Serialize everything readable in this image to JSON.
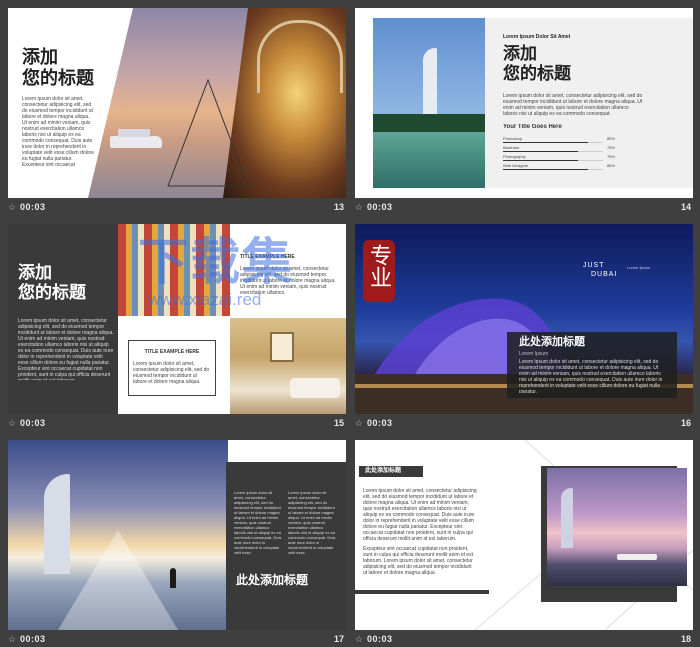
{
  "slides": [
    {
      "number": "13",
      "duration": "00:03",
      "title_line1": "添加",
      "title_line2": "您的标题",
      "body": "Lorem ipsum dolor sit amet, consectetur adipisicing elit, sed do eiusmod tempor incididunt ut labore et dolore magna aliqua. Ut enim ad minim veniam, quis nostrud exercitation ullamco laboris nisi ut aliquip ex ea commodo consequat. Duis aute irure dolor in reprehenderit in voluptate velit esse cillum dolore eu fugiat nulla pariatur. Excepteur sint occaecat cupidatat non proident, sunt in culpa qui officia deserunt mollit anim id est laborum."
    },
    {
      "number": "14",
      "duration": "00:03",
      "kicker": "Lorem Ipsum Dolor Sit Amet",
      "title_line1": "添加",
      "title_line2": "您的标题",
      "body": "Lorem ipsum dolor sit amet, consectetur adipisicing elit, sed do eiusmod tempor incididunt ut labore et dolore magna aliqua. Ut enim ad minim veniam, quis nostrud exercitation ullamco laboris nisi ut aliquip ex ea commodo consequat.",
      "subtitle": "Your Title Goes Here",
      "bars": [
        {
          "label": "Photoshop",
          "value": "85%",
          "fraction": 0.85
        },
        {
          "label": "Illustrator",
          "value": "75%",
          "fraction": 0.75
        },
        {
          "label": "Photography",
          "value": "75%",
          "fraction": 0.75
        },
        {
          "label": "Web Designer",
          "value": "85%",
          "fraction": 0.85
        }
      ]
    },
    {
      "number": "15",
      "duration": "00:03",
      "title_line1": "添加",
      "title_line2": "您的标题",
      "body": "Lorem ipsum dolor sit amet, consectetur adipisicing elit, sed do eiusmod tempor incididunt ut labore et dolore magna aliqua. Ut enim ad minim veniam, quis nostrud exercitation ullamco laboris nisi ut aliquip ex ea commodo consequat. Duis aute irure dolor in reprehenderit in voluptate velit esse cillum dolore eu fugiat nulla pariatur. Excepteur sint occaecat cupidatat non proident, sunt in culpa qui officia deserunt mollit anim id est laborum.",
      "box_title": "TITLE EXAMPLE HERE",
      "box_body": "Lorem ipsum dolor sit amet, consectetur adipisicing elit, sed do eiusmod tempor incididunt ut labore et dolore magna aliqua.",
      "side_title": "TITLE EXAMPLE HERE",
      "side_body": "Lorem ipsum dolor sit amet, consectetur adipisicing elit, sed do eiusmod tempor incididunt ut labore et dolore magna aliqua. Ut enim ad minim veniam, quis nostrud exercitation ullamco."
    },
    {
      "number": "16",
      "duration": "00:03",
      "just": "JUST",
      "dubai": "DUBAI",
      "tagline": "Lorem Ipsum",
      "seal": "专业",
      "panel_title": "此处添加标题",
      "panel_sub": "Lorem Ipsum",
      "panel_body": "Lorem ipsum dolor sit amet, consectetur adipisicing elit, sed do eiusmod tempor incididunt ut labore et dolore magna aliqua. Ut enim ad minim veniam, quis nostrud exercitation ullamco laboris nisi ut aliquip ex ea commodo consequat. Duis aute irure dolor in reprehenderit in voluptate velit esse cillum dolore eu fugiat nulla pariatur."
    },
    {
      "number": "17",
      "duration": "00:03",
      "col1": "Lorem ipsum dolor sit amet, consectetur adipisicing elit, sed do eiusmod tempor incididunt ut labore et dolore magna aliqua. Ut enim ad minim veniam, quis nostrud exercitation ullamco laboris nisi ut aliquip ex ea commodo consequat. Duis aute irure dolor in reprehenderit in voluptate velit esse.",
      "col2": "Lorem ipsum dolor sit amet, consectetur adipisicing elit, sed do eiusmod tempor incididunt ut labore et dolore magna aliqua. Ut enim ad minim veniam, quis nostrud exercitation ullamco laboris nisi ut aliquip ex ea commodo consequat. Duis aute irure dolor in reprehenderit in voluptate velit esse.",
      "title": "此处添加标题"
    },
    {
      "number": "18",
      "duration": "00:03",
      "title": "此处添加标题",
      "body1": "Lorem ipsum dolor sit amet, consectetur adipisicing elit, sed do eiusmod tempor incididunt ut labore et dolore magna aliqua. Ut enim ad minim veniam, quis nostrud exercitation ullamco laboris nisi ut aliquip ex ea commodo consequat. Duis aute irure dolor in reprehenderit in voluptate velit esse cillum dolore eu fugiat nulla pariatur. Excepteur sint occaecat cupidatat non proident, sunt in culpa qui officia deserunt mollit anim id est laborum.",
      "body2": "Excepteur sint occaecat cupidatat non proident, sunt in culpa qui officia deserunt mollit anim id est laborum. Lorem ipsum dolor sit amet, consectetur adipisicing elit, sed do eiusmod tempor incididunt ut labore et dolore magna aliqua."
    }
  ],
  "watermark": {
    "line1": "下载集",
    "line2": "www.xiazai.red"
  },
  "colors": {
    "background": "#3f3f3f",
    "dark_panel": "#3a3a3a",
    "seal_red": "#9e1b1b"
  }
}
